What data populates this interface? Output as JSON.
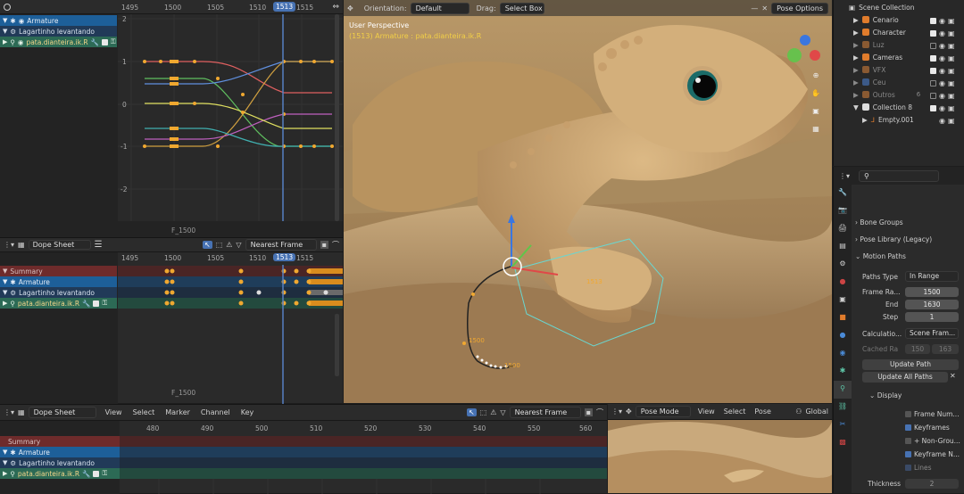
{
  "graph": {
    "frames": [
      "1495",
      "1500",
      "1505",
      "1510",
      "1515"
    ],
    "current": "1513",
    "yticks": [
      "2",
      "1",
      "0",
      "-1",
      "-2"
    ],
    "marker": "F_1500",
    "channels": [
      {
        "label": "Armature"
      },
      {
        "label": "Lagartinho levantando"
      },
      {
        "label": "pata.dianteira.ik.R"
      }
    ]
  },
  "dope1": {
    "mode": "Dope Sheet",
    "snap": "Nearest Frame",
    "frames": [
      "1495",
      "1500",
      "1505",
      "1510",
      "1515"
    ],
    "current": "1513",
    "marker": "F_1500",
    "channels": [
      {
        "label": "Summary"
      },
      {
        "label": "Armature"
      },
      {
        "label": "Lagartinho levantando"
      },
      {
        "label": "pata.dianteira.ik.R"
      }
    ]
  },
  "viewport": {
    "orientation_label": "Orientation:",
    "orientation": "Default",
    "drag_label": "Drag:",
    "drag": "Select Box",
    "pose_options": "Pose Options",
    "title": "User Perspective",
    "subtitle": "(1513) Armature : pata.dianteira.ik.R",
    "frame_labels": [
      "1513",
      "1500",
      "1500"
    ]
  },
  "dope2": {
    "mode": "Dope Sheet",
    "menus": [
      "View",
      "Select",
      "Marker",
      "Channel",
      "Key"
    ],
    "snap": "Nearest Frame",
    "frames": [
      "480",
      "490",
      "500",
      "510",
      "520",
      "530",
      "540",
      "550",
      "560"
    ],
    "channels": [
      {
        "label": "Summary"
      },
      {
        "label": "Armature"
      },
      {
        "label": "Lagartinho levantando"
      },
      {
        "label": "pata.dianteira.ik.R"
      }
    ]
  },
  "view2": {
    "mode": "Pose Mode",
    "menus": [
      "View",
      "Select",
      "Pose"
    ],
    "transform": "Global"
  },
  "outliner": {
    "root": "Scene Collection",
    "items": [
      {
        "label": "Cenario"
      },
      {
        "label": "Character"
      },
      {
        "label": "Luz"
      },
      {
        "label": "Cameras"
      },
      {
        "label": "VFX"
      },
      {
        "label": "Ceu"
      },
      {
        "label": "Outros",
        "count": "6"
      },
      {
        "label": "Collection 8"
      },
      {
        "label": "Empty.001"
      }
    ]
  },
  "props": {
    "bone_groups": "Bone Groups",
    "pose_library": "Pose Library (Legacy)",
    "motion_paths": "Motion Paths",
    "paths_type_label": "Paths Type",
    "paths_type": "In Range",
    "frame_range_label": "Frame Ra...",
    "frame_range": "1500",
    "end_label": "End",
    "end": "1630",
    "step_label": "Step",
    "step": "1",
    "calc_label": "Calculatio...",
    "calc": "Scene Fram...",
    "cached_label": "Cached Ra",
    "cached_a": "150",
    "cached_b": "163",
    "update_path": "Update Path",
    "update_all": "Update All Paths",
    "display": "Display",
    "opt_frame_numbers": "Frame Num...",
    "opt_keyframes": "Keyframes",
    "opt_non_group": "+ Non-Grou...",
    "opt_keyframe_n": "Keyframe N...",
    "opt_lines": "Lines",
    "thickness_label": "Thickness",
    "thickness": "2"
  },
  "colors": {
    "accent": "#4772b3",
    "playhead": "#5680c2",
    "keyframe": "#f0a830",
    "summary": "#6e2b2b",
    "armature": "#1d5f99",
    "action": "#213a58",
    "bone": "#2c6a55"
  }
}
